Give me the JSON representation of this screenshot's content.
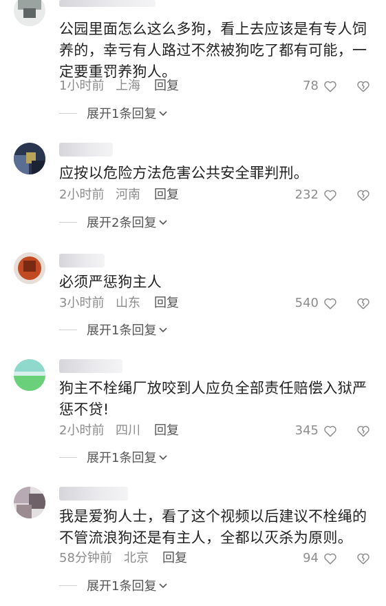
{
  "comments": [
    {
      "text": "公园里面怎么这么多狗，看上去应该是有专人饲养的，幸亏有人路过不然被狗吃了都有可能，一定要重罚养狗人。",
      "time": "1小时前",
      "location": "上海",
      "reply": "回复",
      "likes": "78",
      "expand": "展开1条回复"
    },
    {
      "text": "应按以危险方法危害公共安全罪判刑。",
      "time": "2小时前",
      "location": "河南",
      "reply": "回复",
      "likes": "232",
      "expand": "展开2条回复"
    },
    {
      "text": "必须严惩狗主人",
      "time": "3小时前",
      "location": "山东",
      "reply": "回复",
      "likes": "540",
      "expand": "展开1条回复"
    },
    {
      "text": "狗主不栓绳厂放咬到人应负全部责任赔偿入狱严惩不贷!",
      "time": "2小时前",
      "location": "四川",
      "reply": "回复",
      "likes": "345",
      "expand": "展开1条回复"
    },
    {
      "text": "我是爱狗人士，看了这个视频以后建议不栓绳的不管流浪狗还是有主人，全都以灭杀为原则。",
      "time": "58分钟前",
      "location": "北京",
      "reply": "回复",
      "likes": "94",
      "expand": "展开1条回复"
    }
  ],
  "icons": {
    "like": "heart-outline-icon",
    "dislike": "broken-heart-icon",
    "expand": "chevron-down-icon"
  },
  "colors": {
    "text": "#222222",
    "meta": "#8c8c8c",
    "reply": "#555555"
  }
}
